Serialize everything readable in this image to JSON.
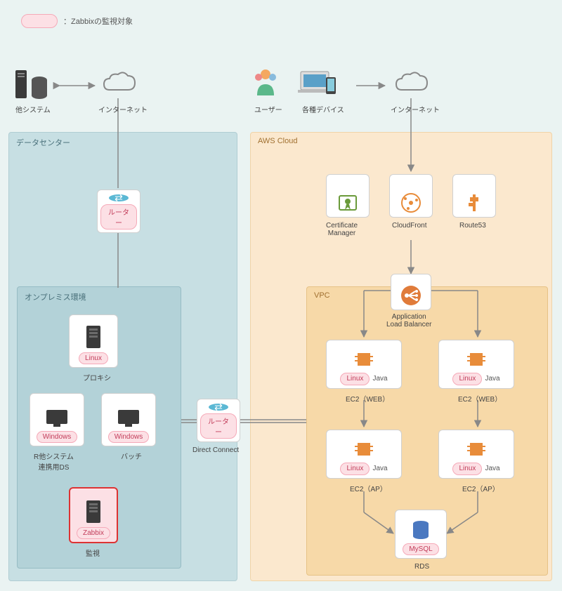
{
  "legend": {
    "label": "：Zabbixの監視対象"
  },
  "top_left": {
    "other_system": "他システム",
    "internet": "インターネット"
  },
  "top_right": {
    "user": "ユーザー",
    "devices": "各種デバイス",
    "internet": "インターネット"
  },
  "datacenter": {
    "title": "データセンター",
    "router": "ルーター"
  },
  "onprem": {
    "title": "オンプレミス環境",
    "proxy": {
      "tag": "Linux",
      "label": "プロキシ"
    },
    "ds": {
      "tag": "Windows",
      "label": "R他システム\n連携用DS"
    },
    "batch": {
      "tag": "Windows",
      "label": "バッチ"
    },
    "zabbix": {
      "tag": "Zabbix",
      "label": "監視"
    }
  },
  "direct_connect": {
    "router": "ルーター",
    "label": "Direct Connect"
  },
  "aws": {
    "title": "AWS Cloud",
    "cert_manager": "Certificate\nManager",
    "cloudfront": "CloudFront",
    "route53": "Route53",
    "alb": "Application\nLoad Balancer",
    "vpc": "VPC",
    "ec2_web": {
      "os": "Linux",
      "lang": "Java",
      "label": "EC2（WEB）"
    },
    "ec2_ap": {
      "os": "Linux",
      "lang": "Java",
      "label": "EC2（AP）"
    },
    "rds": {
      "tag": "MySQL",
      "label": "RDS"
    }
  }
}
